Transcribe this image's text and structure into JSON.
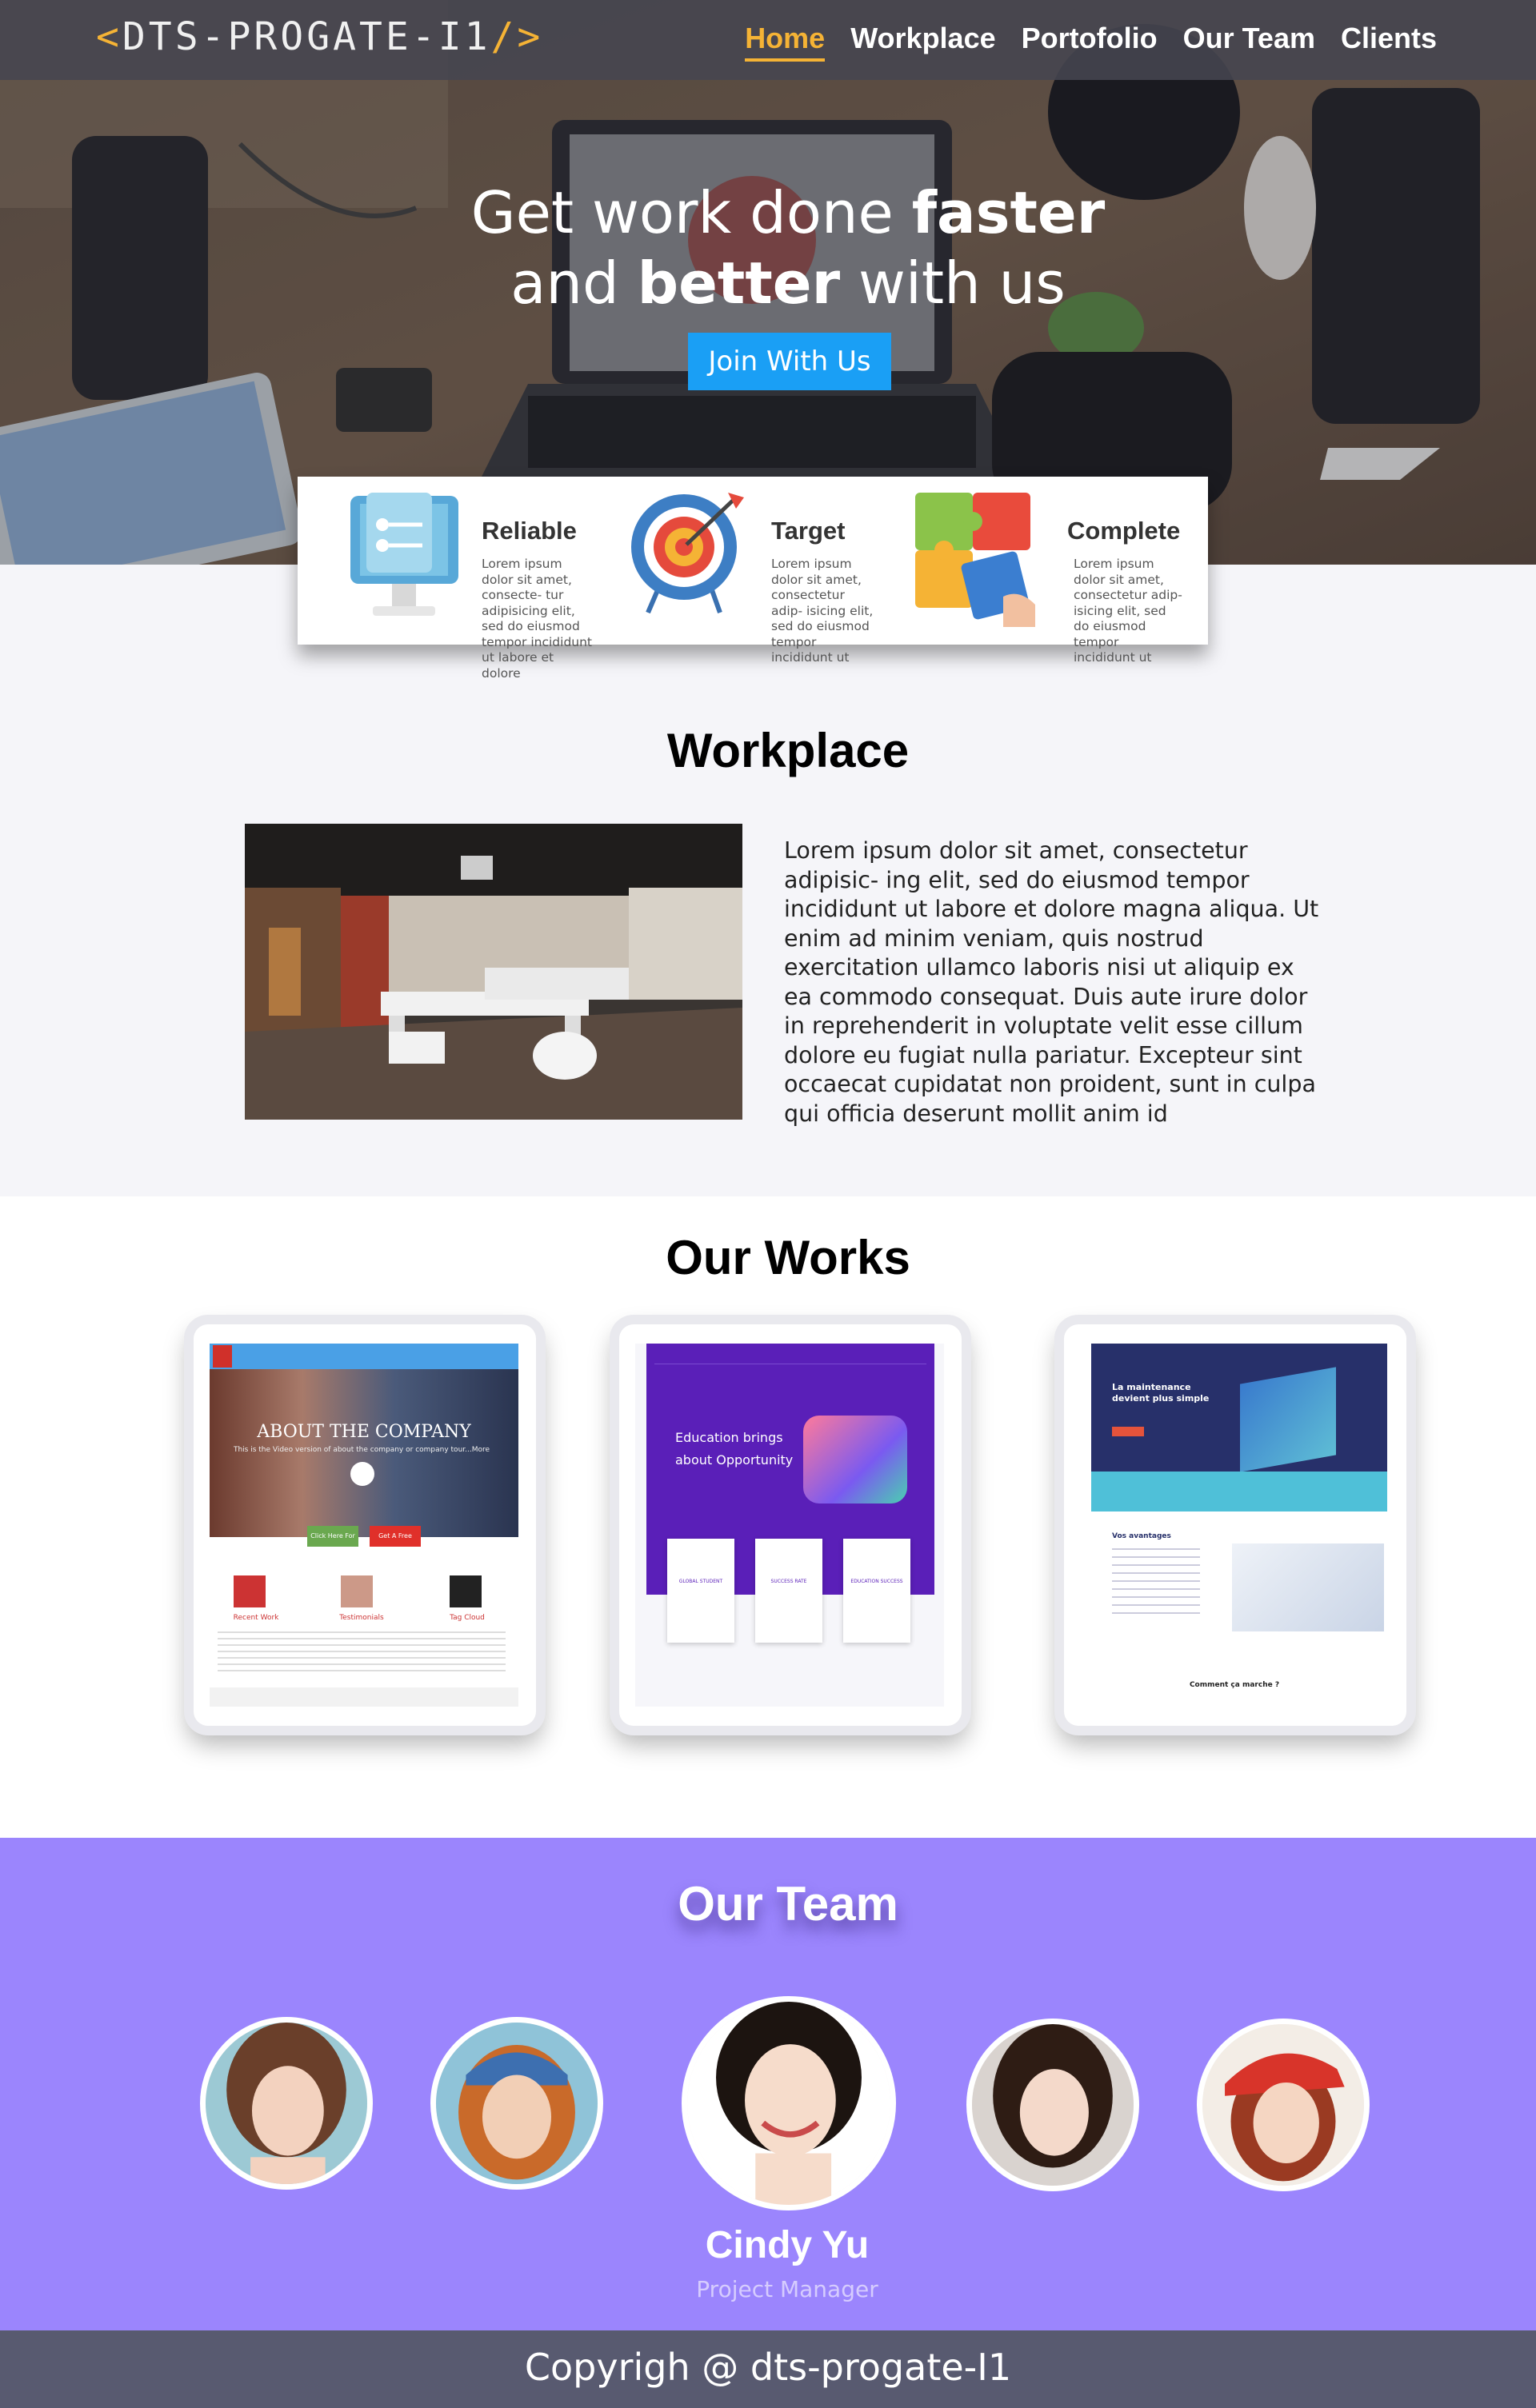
{
  "nav": {
    "logo_text": "DTS-PROGATE-I1",
    "logo_open": "<",
    "logo_close": "/>",
    "items": [
      {
        "label": "Home",
        "active": true
      },
      {
        "label": "Workplace"
      },
      {
        "label": "Portofolio"
      },
      {
        "label": "Our Team"
      },
      {
        "label": "Clients"
      }
    ]
  },
  "hero": {
    "line1_normal": "Get work done ",
    "line1_bold": "faster",
    "line2_normal_a": "and ",
    "line2_bold": "better",
    "line2_normal_b": " with us",
    "button_label": "Join With Us"
  },
  "features": [
    {
      "title": "Reliable",
      "text": "Lorem ipsum dolor sit amet, consecte- tur adipisicing elit, sed do eiusmod tempor incididunt ut labore et dolore",
      "icon": "monitor-icon"
    },
    {
      "title": "Target",
      "text": "Lorem ipsum dolor sit amet, consectetur adip- isicing elit, sed do eiusmod tempor incididunt ut",
      "icon": "target-icon"
    },
    {
      "title": "Complete",
      "text": "Lorem ipsum dolor sit amet, consectetur adip- isicing elit, sed do eiusmod tempor incididunt ut",
      "icon": "puzzle-icon"
    }
  ],
  "workplace": {
    "title": "Workplace",
    "text": "Lorem ipsum dolor sit amet, consectetur adipisic- ing elit, sed do eiusmod tempor incididunt ut labore et dolore magna aliqua. Ut enim ad minim veniam, quis nostrud exercitation ullamco laboris nisi ut aliquip ex ea commodo consequat. Duis aute irure dolor in reprehenderit in voluptate velit esse cillum dolore eu fugiat nulla pariatur. Excepteur sint occaecat cupidatat non proident, sunt in culpa qui officia deserunt mollit anim id"
  },
  "works": {
    "title": "Our Works",
    "cards": [
      {
        "headline": "ABOUT THE COMPANY",
        "sub": "This is the Video version of about the company or company tour...More",
        "btn1": "Click Here For Chat",
        "btn2": "Get A Free Quote",
        "cols": [
          "Recent Work",
          "Testimonials",
          "Tag Cloud"
        ]
      },
      {
        "headline": "Education brings about Opportunity",
        "cols": [
          "GLOBAL STUDENT",
          "SUCCESS RATE",
          "EDUCATION SUCCESS"
        ]
      },
      {
        "headline": "La maintenance devient plus simple",
        "sub": "Vos avantages",
        "footer": "Comment ça marche ?"
      }
    ]
  },
  "team": {
    "title": "Our Team",
    "featured_name": "Cindy Yu",
    "featured_role": "Project Manager"
  },
  "footer": {
    "text": "Copyrigh @ dts-progate-I1"
  },
  "colors": {
    "accent": "#f5b335",
    "button": "#1a9ff5",
    "team_bg": "#9b85fd",
    "footer_bg": "#585a70"
  }
}
